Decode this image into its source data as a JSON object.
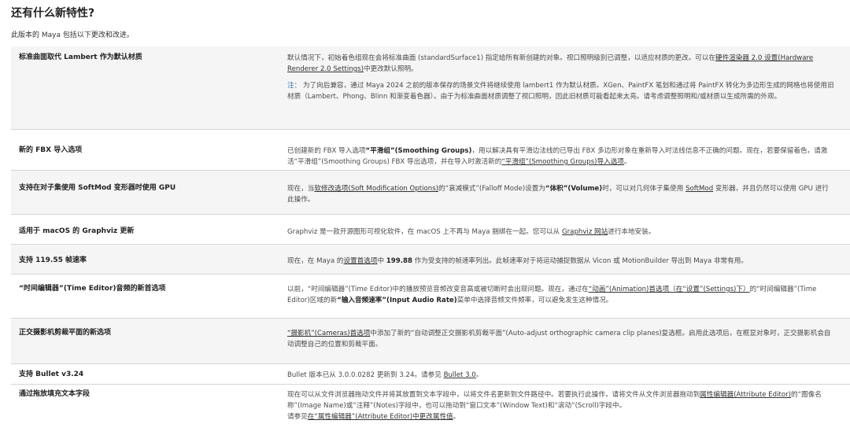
{
  "heading": "还有什么新特性?",
  "intro": "此版本的 Maya 包括以下更改和改进。",
  "rows": [
    {
      "feature": "标准曲面取代 Lambert 作为默认材质",
      "desc1_a": "默认情况下，初始着色组现在会将标准曲面 (standardSurface1) 指定给所有新创建的对象。视口照明级别已调整，以适应材质的更改。可以在",
      "desc1_link": "硬件渲染器 2.0 设置(Hardware Renderer 2.0 Settings)",
      "desc1_b": "中更改默认照明。",
      "note_label": "注：",
      "note_text": "为了向后兼容，通过 Maya 2024 之前的版本保存的场景文件将继续使用 lambert1 作为默认材质。XGen、PaintFX 笔划和通过将 PaintFX 转化为多边形生成的网格也将使用旧材质（Lambert、Phong、Blinn 和渐变着色器）。由于为标准曲面材质调整了视口照明，因此旧材质可能看起来太亮。请考虑调整照明和/或材质以生成所需的外观。"
    },
    {
      "feature": "新的 FBX 导入选项",
      "d_a": "已创建新的 FBX 导入选项",
      "d_b1": "“平滑组”(Smoothing Groups)",
      "d_c": "，用以解决具有平滑边法线的已导出 FBX 多边形对象在重新导入时法线信息不正确的问题。现在，若要保留着色，请激活“平滑组”(Smoothing Groups) FBX 导出选项，并在导入时激活新的",
      "d_link": "“平滑组”(Smoothing Groups)导入选项",
      "d_d": "。"
    },
    {
      "feature": "支持在对子集使用 SoftMod 变形器时使用 GPU",
      "d_a": "现在，当",
      "d_link1": "软修改选项(Soft Modification Options)",
      "d_b": "的“衰减模式”(Falloff Mode)设置为",
      "d_bold": "“体积”(Volume)",
      "d_c": "时，可以对几何体子集使用 ",
      "d_link2": "SoftMod",
      "d_d": " 变形器，并且仍然可以使用 GPU 进行此操作。"
    },
    {
      "feature": "适用于 macOS 的 Graphviz 更新",
      "d_a": "Graphviz 是一款开源图形可视化软件，在 macOS 上不再与 Maya 捆绑在一起。您可以从 ",
      "d_link": "Graphviz 网站",
      "d_b": "进行本地安装。"
    },
    {
      "feature": "支持 119.55 帧速率",
      "d_a": "现在，在 Maya 的",
      "d_link": "设置首选项",
      "d_b": "中 ",
      "d_bold": "199.88",
      "d_c": " 作为受支持的帧速率列出。此帧速率对于将运动捕捉数据从 Vicon 或 MotionBuilder 导出到 Maya 非常有用。"
    },
    {
      "feature": "“时间编辑器”(Time Editor)音频的新首选项",
      "d_a": "以前，“时间编辑器”(Time Editor)中的播放预览音频改变音高或被切断时会出现问题。现在，通过在",
      "d_link": "“动画”(Animation)首选项（在“设置”(Settings)下）",
      "d_b": "的“时间编辑器”(Time Editor)区域的新",
      "d_bold": "“输入音频速率”(Input Audio Rate)",
      "d_c": "菜单中选择音频文件频率，可以避免发生这种情况。"
    },
    {
      "feature": "正交摄影机剪裁平面的新选项",
      "d_link": "“摄影机”(Cameras)首选项",
      "d_a": "中添加了新的“自动调整正交摄影机剪裁平面”(Auto-adjust orthographic camera clip planes)复选框。启用此选项后，在框显对象时，正交摄影机会自动调整自己的位置和剪裁平面。"
    },
    {
      "feature": "支持 Bullet v3.24",
      "d_a": "Bullet 版本已从 3.0.0.0282 更新到 3.24。请参见 ",
      "d_link": "Bullet 3.0",
      "d_b": "。"
    },
    {
      "feature": "通过拖放填充文本字段",
      "d_a": "现在可以从文件浏览器拖动文件并将其放置到文本字段中，以将文件名更新到文件路径中。若要执行此操作，请将文件从文件浏览器拖动到",
      "d_link1": "属性编辑器(Attribute Editor)",
      "d_b": "的“图像名称”(Image Name)或“注释”(Notes)字段中，也可以拖动到“窗口文本”(Window Text)和“滚动”(Scroll)字段中。",
      "d_c": "请参见",
      "d_link2": "在“属性编辑器”(Attribute Editor)中更改属性值",
      "d_d": "。"
    }
  ]
}
